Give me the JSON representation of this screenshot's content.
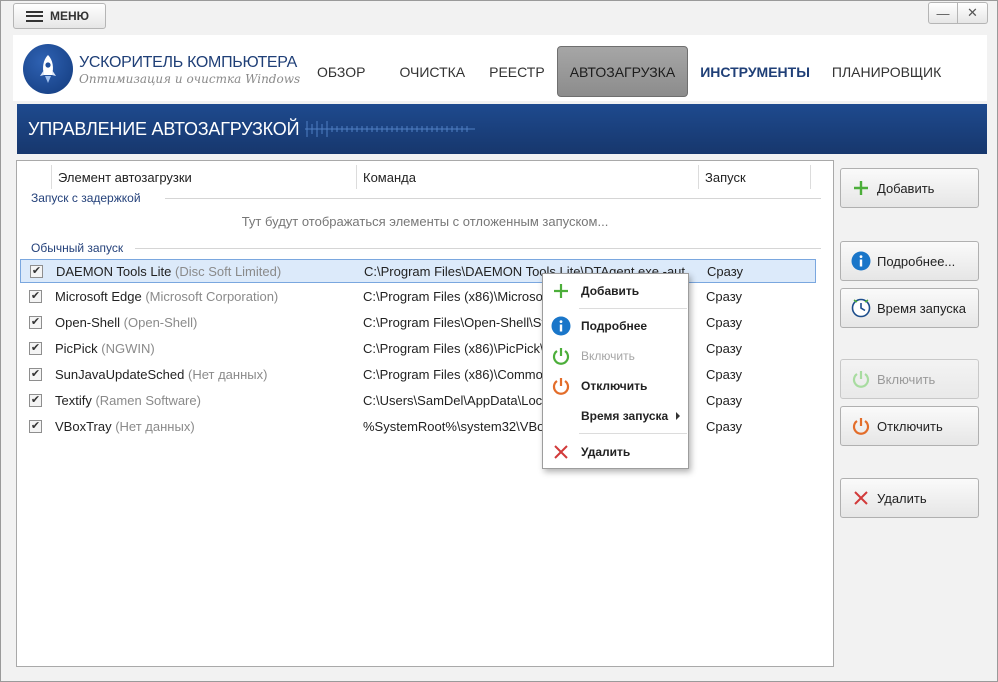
{
  "topbar": {
    "menu_label": "МЕНЮ",
    "minimize_glyph": "—",
    "close_glyph": "✕"
  },
  "brand": {
    "title": "УСКОРИТЕЛЬ КОМПЬЮТЕРА",
    "subtitle": "Оптимизация и очистка Windows",
    "logo_icon": "rocket-icon"
  },
  "nav": {
    "tabs": [
      {
        "label": "ОБЗОР"
      },
      {
        "label": "ОЧИСТКА"
      },
      {
        "label": "РЕЕСТР"
      },
      {
        "label": "АВТОЗАГРУЗКА"
      },
      {
        "label": "ИНСТРУМЕНТЫ"
      },
      {
        "label": "ПЛАНИРОВЩИК"
      }
    ],
    "active": "АВТОЗАГРУЗКА"
  },
  "banner": {
    "title": "УПРАВЛЕНИЕ АВТОЗАГРУЗКОЙ"
  },
  "table": {
    "columns": [
      "Элемент автозагрузки",
      "Команда",
      "Запуск"
    ],
    "delayed_group": {
      "label": "Запуск с задержкой",
      "empty_text": "Тут будут отображаться элементы с отложенным запуском..."
    },
    "normal_group": {
      "label": "Обычный запуск"
    },
    "rows": [
      {
        "name": "DAEMON Tools Lite",
        "vendor": "(Disc Soft Limited)",
        "command": "C:\\Program Files\\DAEMON Tools Lite\\DTAgent.exe -aut",
        "start": "Сразу",
        "checked": true
      },
      {
        "name": "Microsoft Edge",
        "vendor": "(Microsoft Corporation)",
        "command": "C:\\Program Files (x86)\\Microso",
        "start": "Сразу",
        "checked": true
      },
      {
        "name": "Open-Shell",
        "vendor": "(Open-Shell)",
        "command": "C:\\Program Files\\Open-Shell\\St",
        "start": "Сразу",
        "checked": true
      },
      {
        "name": "PicPick",
        "vendor": "(NGWIN)",
        "command": "C:\\Program Files (x86)\\PicPick\\",
        "start": "Сразу",
        "checked": true
      },
      {
        "name": "SunJavaUpdateSched",
        "vendor": "(Нет данных)",
        "command": "C:\\Program Files (x86)\\Commo",
        "start": "Сразу",
        "checked": true
      },
      {
        "name": "Textify",
        "vendor": "(Ramen Software)",
        "command": "C:\\Users\\SamDel\\AppData\\Loca",
        "start": "Сразу",
        "checked": true
      },
      {
        "name": "VBoxTray",
        "vendor": "(Нет данных)",
        "command": "%SystemRoot%\\system32\\VBox",
        "start": "Сразу",
        "checked": true
      }
    ]
  },
  "sidebar": {
    "add": "Добавить",
    "details": "Подробнее...",
    "start_time": "Время запуска",
    "enable": "Включить",
    "disable": "Отключить",
    "delete": "Удалить"
  },
  "context_menu": {
    "add": "Добавить",
    "details": "Подробнее",
    "enable": "Включить",
    "disable": "Отключить",
    "start_time": "Время запуска",
    "delete": "Удалить"
  },
  "colors": {
    "banner": "#1e4a8e",
    "accent_green": "#4cae3a",
    "accent_blue": "#1a76c9",
    "accent_orange": "#e36d2a",
    "delete_red": "#d23a3a",
    "selected_row": "#dceafa"
  }
}
